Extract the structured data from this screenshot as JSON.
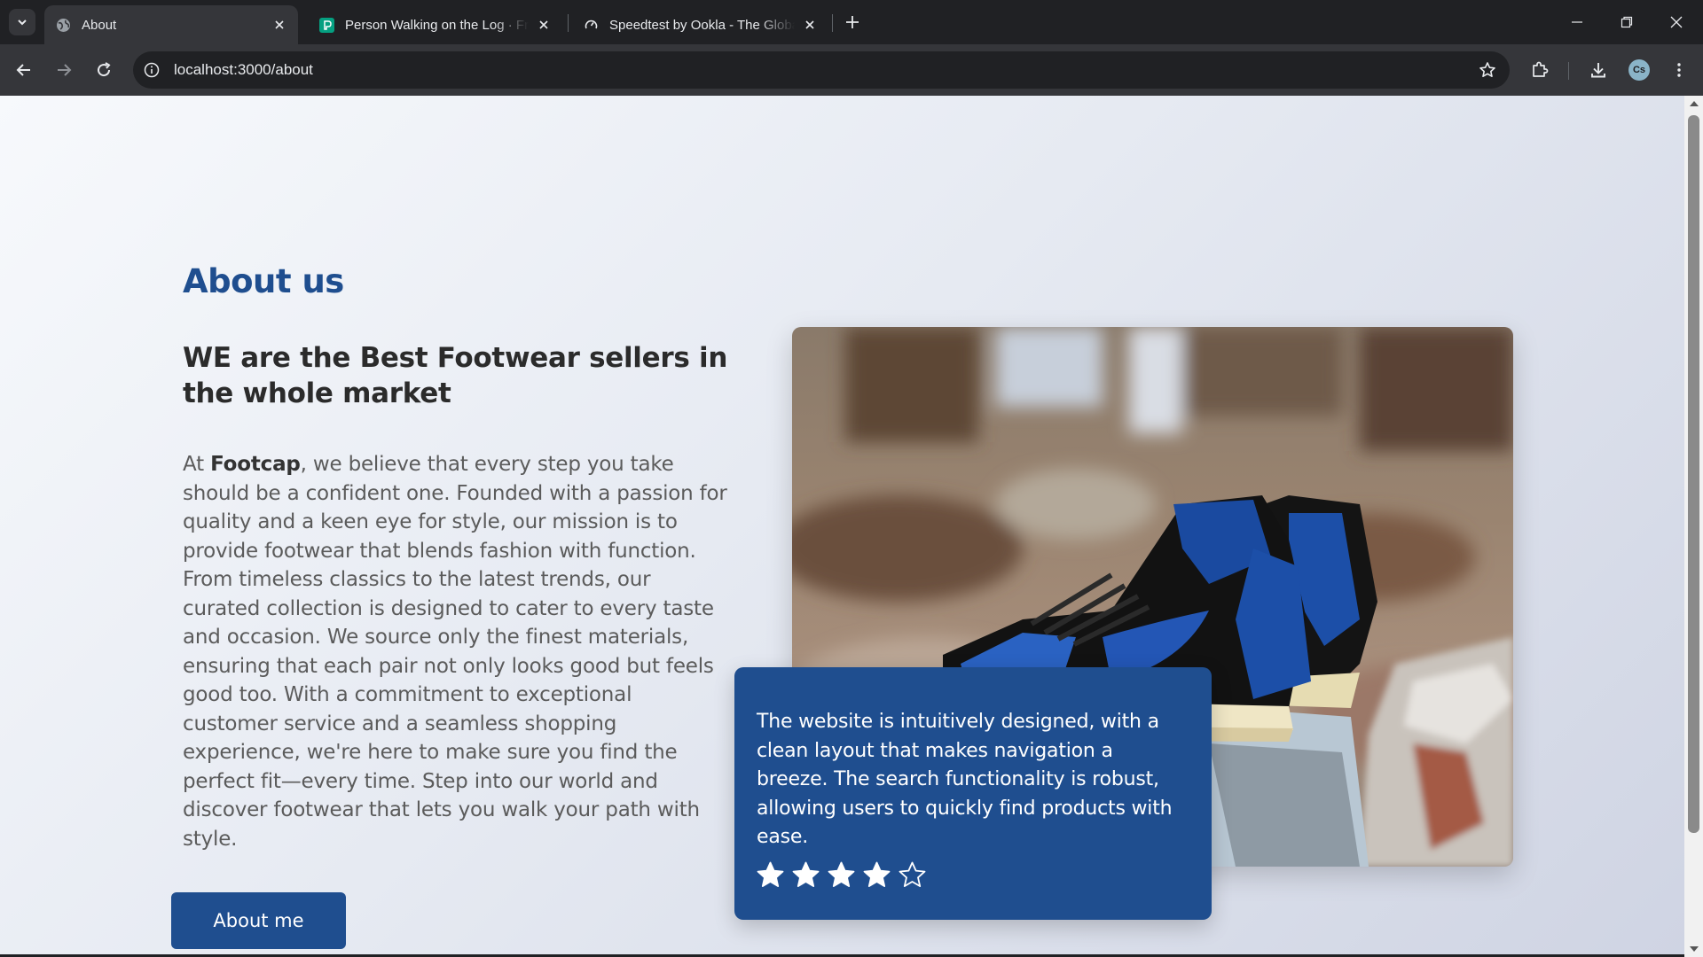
{
  "browser": {
    "tabs": [
      {
        "title": "About",
        "favicon": "globe-icon"
      },
      {
        "title": "Person Walking on the Log · Free",
        "favicon": "pexels-icon"
      },
      {
        "title": "Speedtest by Ookla - The Global",
        "favicon": "speedtest-icon"
      }
    ],
    "url": "localhost:3000/about",
    "profile_initials": "Cs"
  },
  "page": {
    "heading": "About us",
    "headline": "WE are the Best Footwear sellers in the whole market",
    "body_prefix": "At ",
    "brand": "Footcap",
    "body_rest": ", we believe that every step you take should be a confident one. Founded with a passion for quality and a keen eye for style, our mission is to provide footwear that blends fashion with function. From timeless classics to the latest trends, our curated collection is designed to cater to every taste and occasion. We source only the finest materials, ensuring that each pair not only looks good but feels good too. With a commitment to exceptional customer service and a seamless shopping experience, we're here to make sure you find the perfect fit—every time. Step into our world and discover footwear that lets you walk your path with style.",
    "button_label": "About me",
    "image_subject": "blue-black-high-top-sneakers-on-rubble",
    "review": {
      "text": "The website is intuitively designed, with a clean layout that makes navigation a breeze. The search functionality is robust, allowing users to quickly find products with ease.",
      "rating": 4,
      "max_rating": 5
    }
  },
  "colors": {
    "accent": "#1f4e8f",
    "chrome_dark": "#202124",
    "chrome_toolbar": "#35363a"
  }
}
